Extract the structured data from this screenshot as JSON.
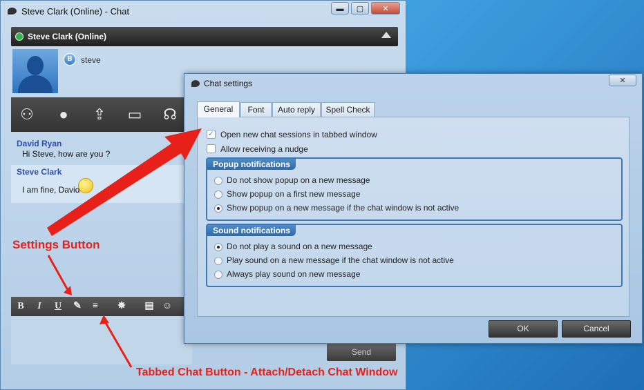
{
  "chat_window": {
    "title": "Steve Clark (Online) - Chat",
    "minimize": "▬",
    "maximize": "▢",
    "close": "✕",
    "contact_name": "Steve Clark (Online)",
    "username": "steve",
    "status_badge": "B",
    "messages": [
      {
        "sender": "David Ryan",
        "text": "Hi Steve, how are you ?"
      },
      {
        "sender": "Steve Clark",
        "text": "I am fine, David"
      }
    ],
    "format": {
      "bold": "B",
      "italic": "I",
      "underline": "U"
    },
    "send_label": "Send"
  },
  "dialog": {
    "title": "Chat settings",
    "close": "✕",
    "tabs": [
      {
        "label": "General"
      },
      {
        "label": "Font"
      },
      {
        "label": "Auto reply"
      },
      {
        "label": "Spell Check"
      }
    ],
    "options": {
      "tabbed": {
        "label": "Open new chat sessions in tabbed window",
        "checked": true
      },
      "nudge": {
        "label": "Allow receiving a nudge",
        "checked": false
      }
    },
    "popup_group": {
      "title": "Popup notifications",
      "options": [
        {
          "label": "Do not show popup on a new message",
          "selected": false
        },
        {
          "label": "Show popup on a first new message",
          "selected": false
        },
        {
          "label": "Show popup on a new message if the chat window is not active",
          "selected": true
        }
      ]
    },
    "sound_group": {
      "title": "Sound notifications",
      "options": [
        {
          "label": "Do not play a sound on a new message",
          "selected": true
        },
        {
          "label": "Play sound on a new message if the chat window is not active",
          "selected": false
        },
        {
          "label": "Always play sound on new message",
          "selected": false
        }
      ]
    },
    "ok_label": "OK",
    "cancel_label": "Cancel"
  },
  "annotations": {
    "settings": "Settings Button",
    "tabbed": "Tabbed Chat Button - Attach/Detach Chat Window"
  },
  "colors": {
    "annotation": "#e8201a",
    "group_border": "#3d78b4",
    "sender": "#2d4fb0"
  }
}
